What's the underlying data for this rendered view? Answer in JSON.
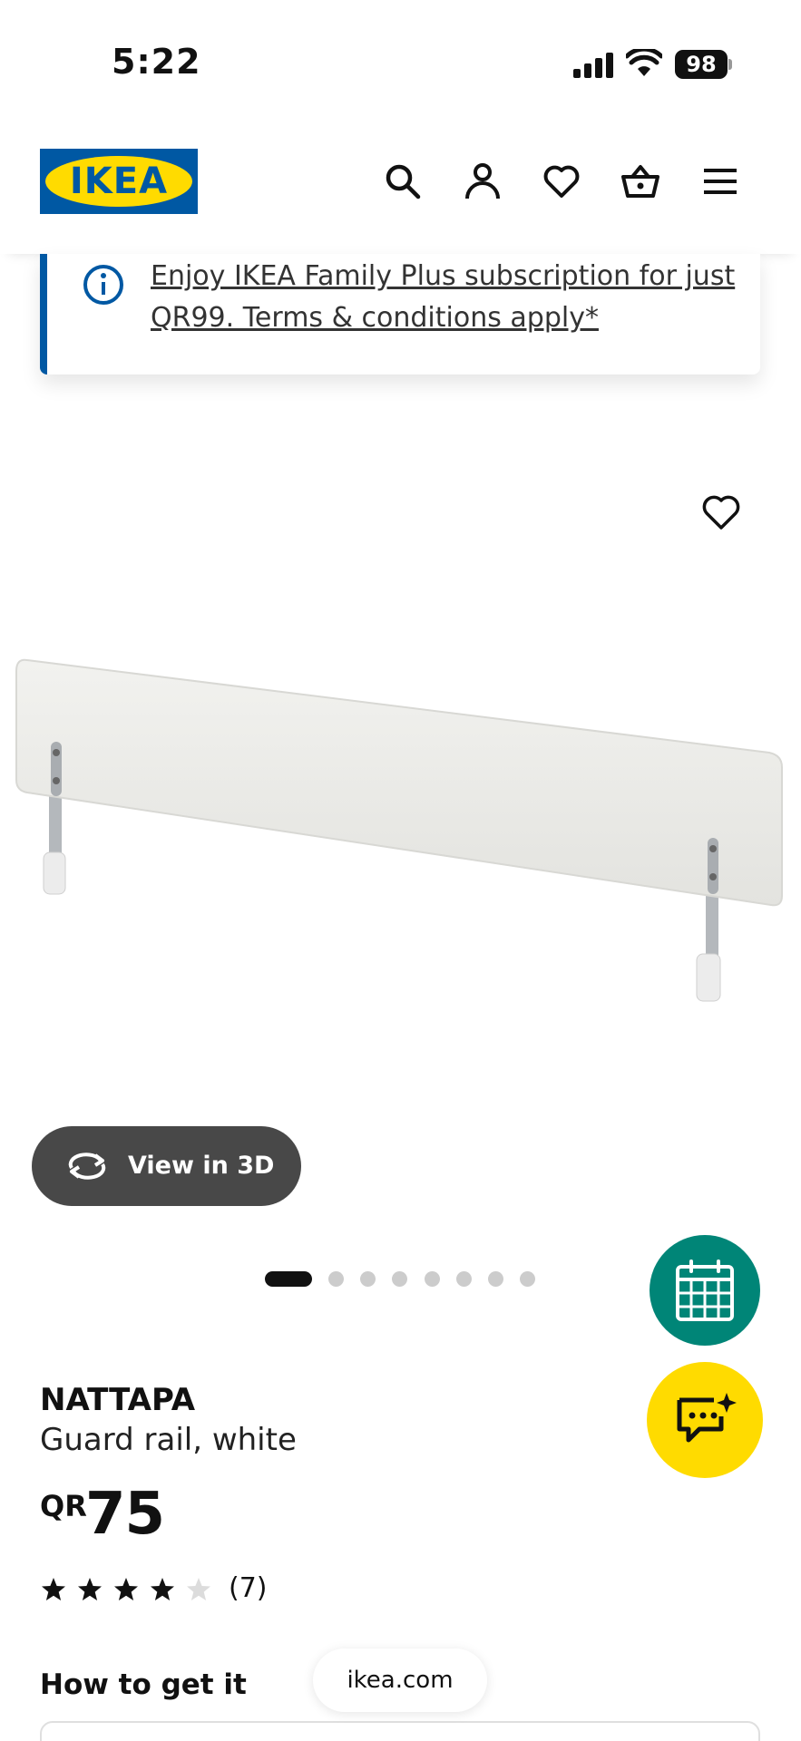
{
  "status_bar": {
    "time": "5:22",
    "battery": "98"
  },
  "header": {
    "logo_text": "IKEA",
    "icons": [
      "search-icon",
      "profile-icon",
      "heart-icon",
      "basket-icon",
      "menu-icon"
    ]
  },
  "notice": {
    "text": "Enjoy IKEA Family Plus subscription for just QR99. Terms & conditions apply*",
    "icon": "info-icon"
  },
  "gallery": {
    "view3d_label": "View in 3D",
    "total_images": 8,
    "active_index": 0
  },
  "product": {
    "name": "NATTAPA",
    "description": "Guard rail, white",
    "currency": "QR",
    "price": "75",
    "rating": 4,
    "rating_max": 5,
    "review_count": "(7)"
  },
  "sections": {
    "how_to_get": "How to get it"
  },
  "browser": {
    "url": "ikea.com"
  },
  "colors": {
    "brand_blue": "#0058a3",
    "brand_yellow": "#ffdb00",
    "teal": "#008577",
    "dark_button": "#484848"
  }
}
